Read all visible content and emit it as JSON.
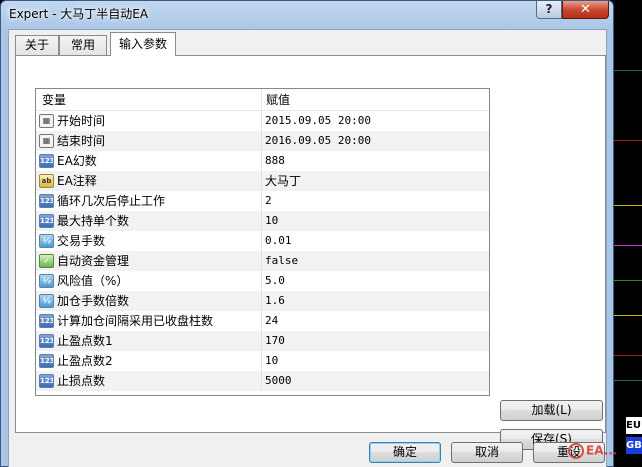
{
  "window": {
    "title": "Expert - 大马丁半自动EA",
    "help_label": "?",
    "close_label": "✕"
  },
  "tabs": [
    {
      "label": "关于"
    },
    {
      "label": "常用"
    },
    {
      "label": "输入参数"
    }
  ],
  "grid": {
    "col_variable": "变量",
    "col_value": "赋值",
    "rows": [
      {
        "icon": "date",
        "name": "开始时间",
        "value": "2015.09.05 20:00"
      },
      {
        "icon": "date",
        "name": "结束时间",
        "value": "2016.09.05 20:00"
      },
      {
        "icon": "int",
        "name": "EA幻数",
        "value": "888"
      },
      {
        "icon": "string",
        "name": "EA注释",
        "value": "大马丁"
      },
      {
        "icon": "int",
        "name": "循环几次后停止工作",
        "value": "2"
      },
      {
        "icon": "int",
        "name": "最大持单个数",
        "value": "10"
      },
      {
        "icon": "double",
        "name": "交易手数",
        "value": "0.01"
      },
      {
        "icon": "bool",
        "name": "自动资金管理",
        "value": "false"
      },
      {
        "icon": "double",
        "name": "风险值（%）",
        "value": "5.0"
      },
      {
        "icon": "double",
        "name": "加仓手数倍数",
        "value": "1.6"
      },
      {
        "icon": "int",
        "name": "计算加仓间隔采用已收盘柱数",
        "value": "24"
      },
      {
        "icon": "int",
        "name": "止盈点数1",
        "value": "170"
      },
      {
        "icon": "int",
        "name": "止盈点数2",
        "value": "10"
      },
      {
        "icon": "int",
        "name": "止损点数",
        "value": "5000"
      }
    ]
  },
  "buttons": {
    "load": "加载(L)",
    "save": "保存(S)",
    "ok": "确定",
    "cancel": "取消",
    "reset": "重设"
  },
  "icon_glyphs": {
    "int": "123",
    "double": "½",
    "string": "ab",
    "bool": "✓",
    "date": "▦"
  },
  "side_tags": {
    "eu": "EU",
    "gb": "GB"
  },
  "watermark": "EA..."
}
